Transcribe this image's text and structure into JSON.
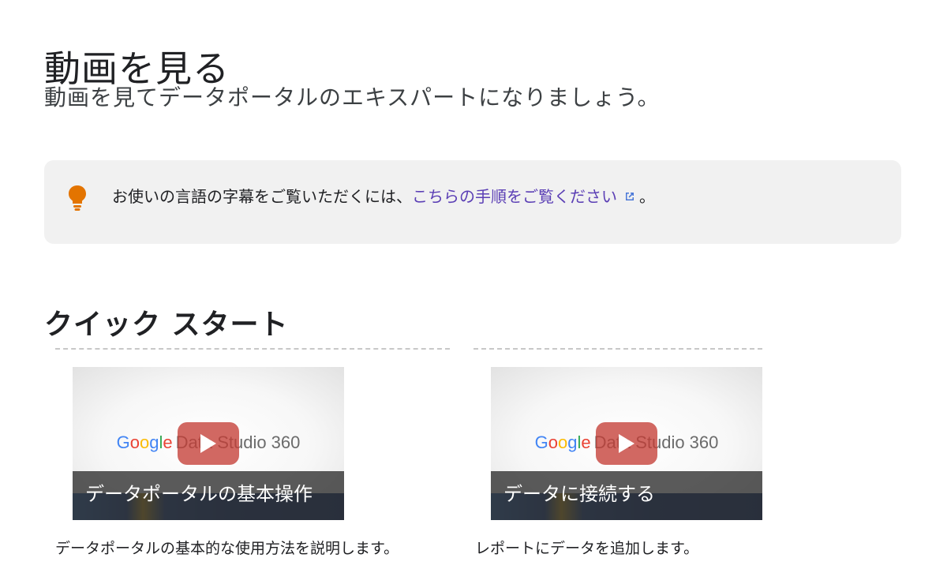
{
  "header": {
    "title": "動画を見る",
    "subtitle": "動画を見てデータポータルのエキスパートになりましょう。"
  },
  "tip": {
    "icon": "lightbulb-icon",
    "icon_color": "#e37400",
    "text": "お使いの言語の字幕をご覧いただくには、",
    "link_text": "こちらの手順をご覧ください",
    "link_color": "#5b3fb5",
    "link_icon": "external-link-icon",
    "suffix": "。"
  },
  "section": {
    "title": "クイック スタート"
  },
  "thumbnail_brand": {
    "google": [
      "G",
      "o",
      "o",
      "g",
      "l",
      "e"
    ],
    "product": "Data Studio 360"
  },
  "videos": [
    {
      "caption": "データポータルの基本操作",
      "description": "データポータルの基本的な使用方法を説明します。"
    },
    {
      "caption": "データに接続する",
      "description": "レポートにデータを追加します。"
    }
  ]
}
